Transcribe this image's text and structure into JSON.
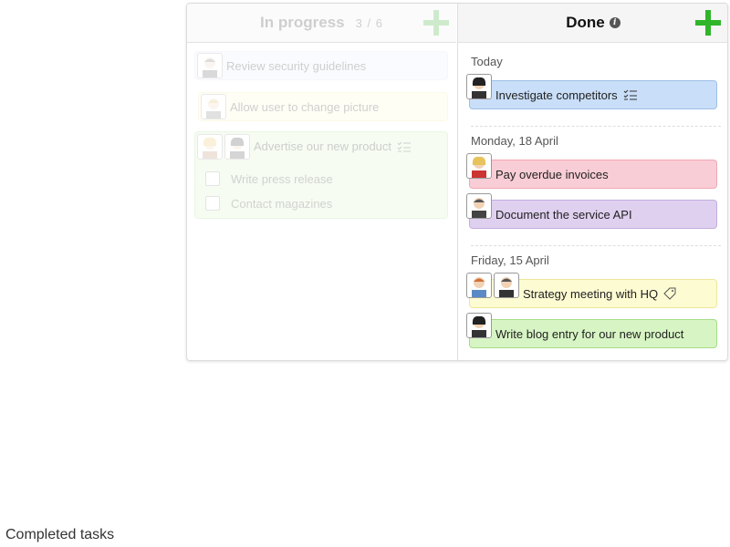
{
  "board": {
    "in_progress": {
      "title": "In progress",
      "count": "3 / 6",
      "cards": [
        {
          "text": "Review security guidelines",
          "color": "#e9ecfb"
        },
        {
          "text": "Allow user to change picture",
          "color": "#fdfbd2"
        },
        {
          "text": "Advertise our new product",
          "color": "#d7f5c4"
        }
      ],
      "subtasks": [
        {
          "text": "Write press release"
        },
        {
          "text": "Contact magazines"
        }
      ]
    },
    "done": {
      "title": "Done",
      "info_icon": "info-icon",
      "sections": [
        {
          "label": "Today",
          "cards": [
            {
              "text": "Investigate competitors",
              "color": "#c9def8"
            }
          ]
        },
        {
          "label": "Monday, 18 April",
          "cards": [
            {
              "text": "Pay overdue invoices",
              "color": "#f9cdd5"
            },
            {
              "text": "Document the service API",
              "color": "#dfd0f0"
            }
          ]
        },
        {
          "label": "Friday, 15 April",
          "cards": [
            {
              "text": "Strategy meeting with HQ",
              "color": "#fdfbd2"
            },
            {
              "text": "Write blog entry for our new product",
              "color": "#d7f5c4"
            }
          ]
        }
      ]
    },
    "accent_color": "#2fb52a"
  },
  "caption": "Completed tasks"
}
